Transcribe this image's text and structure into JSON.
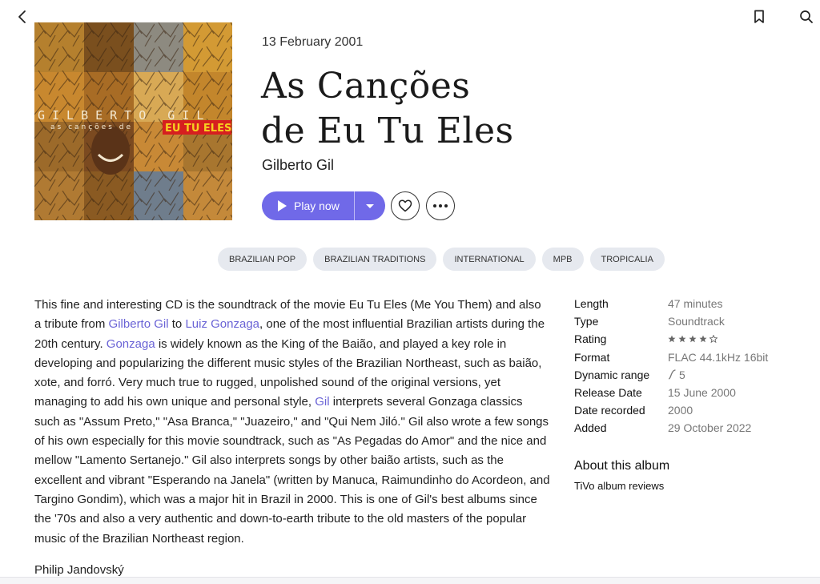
{
  "header": {
    "back_icon": "chevron-left-icon",
    "bookmark_icon": "bookmark-icon",
    "search_icon": "search-icon"
  },
  "album": {
    "date": "13 February 2001",
    "title_line1": "As Canções",
    "title_line2": "de Eu Tu Eles",
    "artist": "Gilberto Gil",
    "cover_text_artist": "GILBERTO GIL",
    "cover_text_sub": "as canções de",
    "cover_text_badge": "EU TU ELES"
  },
  "actions": {
    "play_label": "Play now",
    "accent_color": "#7069e8"
  },
  "genres": [
    "BRAZILIAN POP",
    "BRAZILIAN TRADITIONS",
    "INTERNATIONAL",
    "MPB",
    "TROPICALIA"
  ],
  "review": {
    "p1": "This fine and interesting CD is the soundtrack of the movie Eu Tu Eles (Me You Them) and also a tribute from ",
    "link1": "Gilberto Gil",
    "p2": " to ",
    "link2": "Luiz Gonzaga",
    "p3": ", one of the most influential Brazilian artists during the 20th century. ",
    "link3": "Gonzaga",
    "p4": " is widely known as the King of the Baião, and played a key role in developing and popularizing the different music styles of the Brazilian Northeast, such as baião, xote, and forró. Very much true to rugged, unpolished sound of the original versions, yet managing to add his own unique and personal style, ",
    "link4": "Gil",
    "p5": " interprets several Gonzaga classics such as \"Assum Preto,\" \"Asa Branca,\" \"Juazeiro,\" and \"Qui Nem Jiló.\" Gil also wrote a few songs of his own especially for this movie soundtrack, such as \"As Pegadas do Amor\" and the nice and mellow \"Lamento Sertanejo.\" Gil also interprets songs by other baião artists, such as the excellent and vibrant \"Esperando na Janela\" (written by Manuca, Raimundinho do Acordeon, and Targino Gondim), which was a major hit in Brazil in 2000. This is one of Gil's best albums since the '70s and also a very authentic and down-to-earth tribute to the old masters of the popular music of the Brazilian Northeast region.",
    "author": "Philip Jandovský"
  },
  "details": [
    {
      "label": "Length",
      "value": "47 minutes"
    },
    {
      "label": "Type",
      "value": "Soundtrack"
    },
    {
      "label": "Rating",
      "value": ""
    },
    {
      "label": "Format",
      "value": "FLAC 44.1kHz 16bit"
    },
    {
      "label": "Dynamic range",
      "value": "5"
    },
    {
      "label": "Release Date",
      "value": "15 June 2000"
    },
    {
      "label": "Date recorded",
      "value": "2000"
    },
    {
      "label": "Added",
      "value": "29 October 2022"
    }
  ],
  "rating": {
    "stars": 4,
    "max": 5
  },
  "about": {
    "heading": "About this album",
    "source": "TiVo album reviews"
  }
}
